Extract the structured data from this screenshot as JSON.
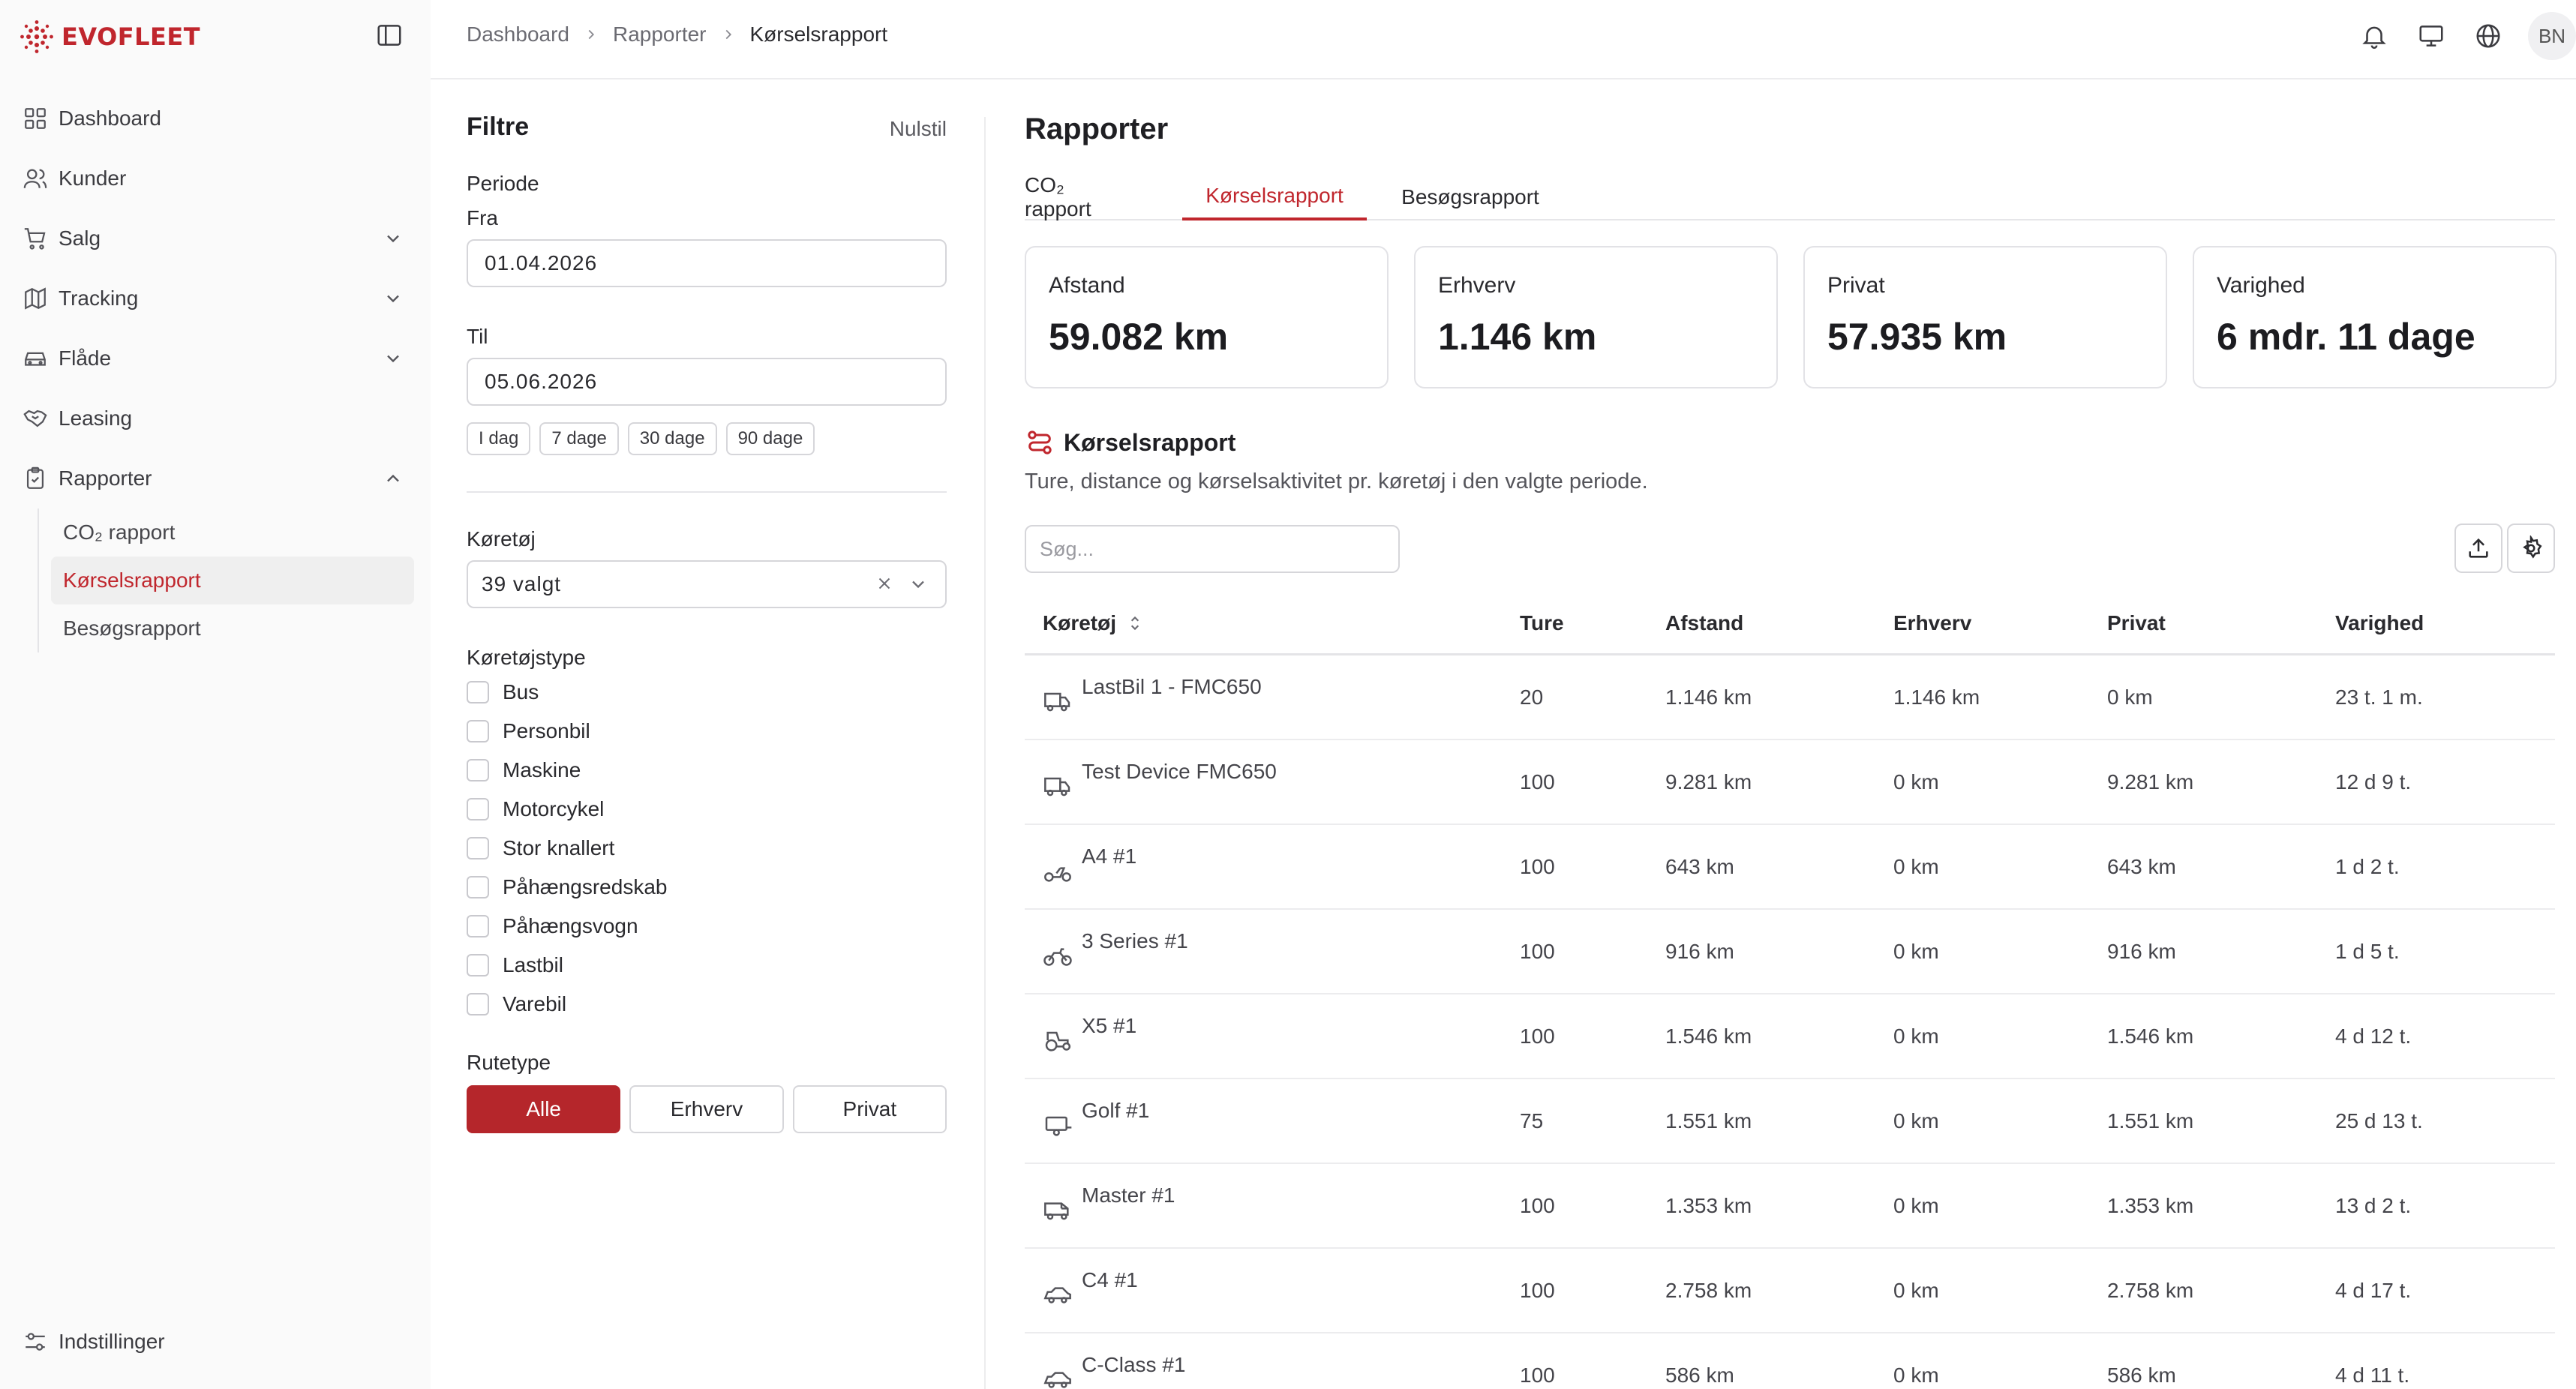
{
  "brand": {
    "name": "EVOFLEET",
    "accent": "#c0262d"
  },
  "sidebar": {
    "items": [
      {
        "label": "Dashboard",
        "icon": "grid-icon"
      },
      {
        "label": "Kunder",
        "icon": "users-icon"
      },
      {
        "label": "Salg",
        "icon": "cart-icon",
        "chevron": "down"
      },
      {
        "label": "Tracking",
        "icon": "map-icon",
        "chevron": "down"
      },
      {
        "label": "Flåde",
        "icon": "car-icon",
        "chevron": "down"
      },
      {
        "label": "Leasing",
        "icon": "handshake-icon"
      },
      {
        "label": "Rapporter",
        "icon": "clipboard-icon",
        "chevron": "up"
      }
    ],
    "subitems": [
      "CO₂ rapport",
      "Kørselsrapport",
      "Besøgsrapport"
    ],
    "active_sub": "Kørselsrapport",
    "settings_label": "Indstillinger"
  },
  "breadcrumb": [
    "Dashboard",
    "Rapporter",
    "Kørselsrapport"
  ],
  "user": {
    "initials": "BN"
  },
  "filters": {
    "title": "Filtre",
    "reset": "Nulstil",
    "period_label": "Periode",
    "from_label": "Fra",
    "from_value": "01.04.2026",
    "to_label": "Til",
    "to_value": "05.06.2026",
    "quick_ranges": [
      "I dag",
      "7 dage",
      "30 dage",
      "90 dage"
    ],
    "vehicle_label": "Køretøj",
    "vehicle_value": "39 valgt",
    "vehicle_type_label": "Køretøjstype",
    "vehicle_types": [
      "Bus",
      "Personbil",
      "Maskine",
      "Motorcykel",
      "Stor knallert",
      "Påhængsredskab",
      "Påhængsvogn",
      "Lastbil",
      "Varebil"
    ],
    "route_type_label": "Rutetype",
    "route_types": [
      "Alle",
      "Erhverv",
      "Privat"
    ],
    "route_type_selected": "Alle"
  },
  "main": {
    "title": "Rapporter",
    "tabs": [
      "CO₂ rapport",
      "Kørselsrapport",
      "Besøgsrapport"
    ],
    "active_tab": "Kørselsrapport",
    "cards": [
      {
        "label": "Afstand",
        "value": "59.082 km"
      },
      {
        "label": "Erhverv",
        "value": "1.146 km"
      },
      {
        "label": "Privat",
        "value": "57.935 km"
      },
      {
        "label": "Varighed",
        "value": "6 mdr. 11 dage"
      }
    ],
    "section_title": "Kørselsrapport",
    "section_subtitle": "Ture, distance og kørselsaktivitet pr. køretøj i den valgte periode.",
    "search_placeholder": "Søg...",
    "columns": [
      "Køretøj",
      "Ture",
      "Afstand",
      "Erhverv",
      "Privat",
      "Varighed"
    ],
    "rows": [
      {
        "icon": "truck-icon",
        "name": "LastBil 1 - FMC650",
        "ture": "20",
        "afstand": "1.146 km",
        "erhverv": "1.146 km",
        "privat": "0 km",
        "varighed": "23 t. 1 m."
      },
      {
        "icon": "truck-icon",
        "name": "Test Device FMC650",
        "ture": "100",
        "afstand": "9.281 km",
        "erhverv": "0 km",
        "privat": "9.281 km",
        "varighed": "12 d 9 t."
      },
      {
        "icon": "scooter-icon",
        "name": "A4 #1",
        "ture": "100",
        "afstand": "643 km",
        "erhverv": "0 km",
        "privat": "643 km",
        "varighed": "1 d 2 t."
      },
      {
        "icon": "motorcycle-icon",
        "name": "3 Series #1",
        "ture": "100",
        "afstand": "916 km",
        "erhverv": "0 km",
        "privat": "916 km",
        "varighed": "1 d 5 t."
      },
      {
        "icon": "tractor-icon",
        "name": "X5 #1",
        "ture": "100",
        "afstand": "1.546 km",
        "erhverv": "0 km",
        "privat": "1.546 km",
        "varighed": "4 d 12 t."
      },
      {
        "icon": "trailer-icon",
        "name": "Golf #1",
        "ture": "75",
        "afstand": "1.551 km",
        "erhverv": "0 km",
        "privat": "1.551 km",
        "varighed": "25 d 13 t."
      },
      {
        "icon": "van-icon",
        "name": "Master #1",
        "ture": "100",
        "afstand": "1.353 km",
        "erhverv": "0 km",
        "privat": "1.353 km",
        "varighed": "13 d 2 t."
      },
      {
        "icon": "car-icon",
        "name": "C4 #1",
        "ture": "100",
        "afstand": "2.758 km",
        "erhverv": "0 km",
        "privat": "2.758 km",
        "varighed": "4 d 17 t."
      },
      {
        "icon": "car-icon",
        "name": "C-Class #1",
        "ture": "100",
        "afstand": "586 km",
        "erhverv": "0 km",
        "privat": "586 km",
        "varighed": "4 d 11 t."
      }
    ]
  }
}
